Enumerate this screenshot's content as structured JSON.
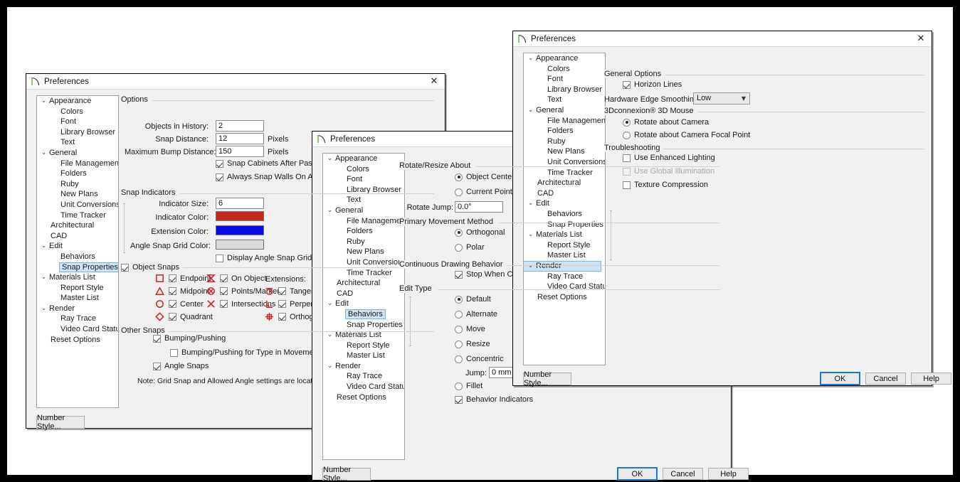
{
  "window_title": "Preferences",
  "close_label": "✕",
  "tree_items": [
    {
      "label": "Appearance",
      "level": 0,
      "chevron": "⌄"
    },
    {
      "label": "Colors",
      "level": 1
    },
    {
      "label": "Font",
      "level": 1
    },
    {
      "label": "Library Browser",
      "level": 1
    },
    {
      "label": "Text",
      "level": 1
    },
    {
      "label": "General",
      "level": 0,
      "chevron": "⌄"
    },
    {
      "label": "File Management",
      "level": 1
    },
    {
      "label": "Folders",
      "level": 1
    },
    {
      "label": "Ruby",
      "level": 1
    },
    {
      "label": "New Plans",
      "level": 1
    },
    {
      "label": "Unit Conversions",
      "level": 1
    },
    {
      "label": "Time Tracker",
      "level": 1
    },
    {
      "label": "Architectural",
      "level": 0
    },
    {
      "label": "CAD",
      "level": 0
    },
    {
      "label": "Edit",
      "level": 0,
      "chevron": "⌄"
    },
    {
      "label": "Behaviors",
      "level": 1
    },
    {
      "label": "Snap Properties",
      "level": 1
    },
    {
      "label": "Materials List",
      "level": 0,
      "chevron": "⌄"
    },
    {
      "label": "Report Style",
      "level": 1
    },
    {
      "label": "Master List",
      "level": 1
    },
    {
      "label": "Render",
      "level": 0,
      "chevron": "⌄"
    },
    {
      "label": "Ray Trace",
      "level": 1
    },
    {
      "label": "Video Card Status",
      "level": 1
    },
    {
      "label": "Reset Options",
      "level": 0
    }
  ],
  "number_style_label": "Number Style...",
  "buttons": {
    "ok": "OK",
    "cancel": "Cancel",
    "help": "Help"
  },
  "dialog1": {
    "selected_tree_item": "Snap Properties",
    "options_group": "Options",
    "fields": [
      {
        "label": "Objects in History:",
        "value": "2",
        "unit": ""
      },
      {
        "label": "Snap Distance:",
        "value": "12",
        "unit": "Pixels"
      },
      {
        "label": "Maximum Bump Distance:",
        "value": "150",
        "unit": "Pixels"
      }
    ],
    "option_checks": [
      {
        "label": "Snap Cabinets After Paste",
        "checked": true
      },
      {
        "label": "Always Snap Walls On Allowed Angles",
        "checked": true
      }
    ],
    "snap_indicators_group": "Snap Indicators",
    "indicator_size_label": "Indicator Size:",
    "indicator_size_value": "6",
    "indicator_color_label": "Indicator Color:",
    "indicator_color": "#c0271d",
    "extension_color_label": "Extension Color:",
    "extension_color": "#0a0ae6",
    "angle_snap_grid_color_label": "Angle Snap Grid Color:",
    "angle_snap_grid_color": "#dcdcdc",
    "display_angle_snap_grid": "Display Angle Snap Grid",
    "display_angle_snap_grid_checked": false,
    "object_snaps_group": "Object Snaps",
    "object_snaps_checked": true,
    "extensions_label": "Extensions:",
    "snap_col1": [
      {
        "label": "Endpoint",
        "icon": "square-icon",
        "checked": true
      },
      {
        "label": "Midpoint",
        "icon": "triangle-icon",
        "checked": true
      },
      {
        "label": "Center",
        "icon": "circle-icon",
        "checked": true
      },
      {
        "label": "Quadrant",
        "icon": "diamond-icon",
        "checked": true
      }
    ],
    "snap_col2": [
      {
        "label": "On Object",
        "icon": "hourglass-icon",
        "checked": true
      },
      {
        "label": "Points/Markers",
        "icon": "circle-x-icon",
        "checked": true
      },
      {
        "label": "Intersections",
        "icon": "x-cross-icon",
        "checked": true
      }
    ],
    "snap_col3": [
      {
        "label": "Tangent",
        "icon": "tangent-icon",
        "checked": true
      },
      {
        "label": "Perpendicular",
        "icon": "perpendicular-icon",
        "checked": true
      },
      {
        "label": "Orthogonal",
        "icon": "orthogonal-icon",
        "checked": true
      }
    ],
    "other_snaps_group": "Other Snaps",
    "other_snaps": [
      {
        "label": "Bumping/Pushing",
        "checked": true
      },
      {
        "label": "Bumping/Pushing for Type in Movement",
        "checked": false
      },
      {
        "label": "Angle Snaps",
        "checked": true
      }
    ],
    "note": "Note: Grid Snap and Allowed Angle settings are located in the Plan Defaults dialog."
  },
  "dialog2": {
    "selected_tree_item": "Behaviors",
    "rotate_resize_group": "Rotate/Resize About",
    "rotate_resize_radios": [
      {
        "label": "Object Center",
        "selected": true
      },
      {
        "label": "Current Point",
        "selected": false
      }
    ],
    "rotate_jump_label": "Rotate Jump:",
    "rotate_jump_value": "0.0°",
    "primary_movement_group": "Primary Movement Method",
    "primary_movement_radios": [
      {
        "label": "Orthogonal",
        "selected": true
      },
      {
        "label": "Polar",
        "selected": false
      }
    ],
    "continuous_group": "Continuous Drawing Behavior",
    "stop_when_connected": "Stop When Connected",
    "stop_when_connected_checked": true,
    "edit_type_group": "Edit Type",
    "edit_type_radios": [
      {
        "label": "Default",
        "selected": true
      },
      {
        "label": "Alternate",
        "selected": false
      },
      {
        "label": "Move",
        "selected": false
      },
      {
        "label": "Resize",
        "selected": false
      },
      {
        "label": "Concentric",
        "selected": false
      }
    ],
    "jump_label": "Jump:",
    "jump_value": "0 mm",
    "fillet_label": "Fillet",
    "fillet_selected": false,
    "behavior_indicators": "Behavior Indicators",
    "behavior_indicators_checked": true
  },
  "dialog3": {
    "selected_tree_item": "Render",
    "general_options_group": "General Options",
    "horizon_lines": "Horizon Lines",
    "horizon_lines_checked": true,
    "hardware_edge_smoothing_label": "Hardware Edge Smoothing:",
    "hardware_edge_smoothing_value": "Low",
    "mouse_group": "3Dconnexion® 3D Mouse",
    "mouse_radios": [
      {
        "label": "Rotate about Camera",
        "selected": true
      },
      {
        "label": "Rotate about Camera Focal Point",
        "selected": false
      }
    ],
    "troubleshooting_group": "Troubleshooting",
    "troubleshooting_checks": [
      {
        "label": "Use Enhanced Lighting",
        "checked": false,
        "disabled": false
      },
      {
        "label": "Use Global Illumination",
        "checked": false,
        "disabled": true
      },
      {
        "label": "Texture Compression",
        "checked": false,
        "disabled": false
      }
    ]
  }
}
